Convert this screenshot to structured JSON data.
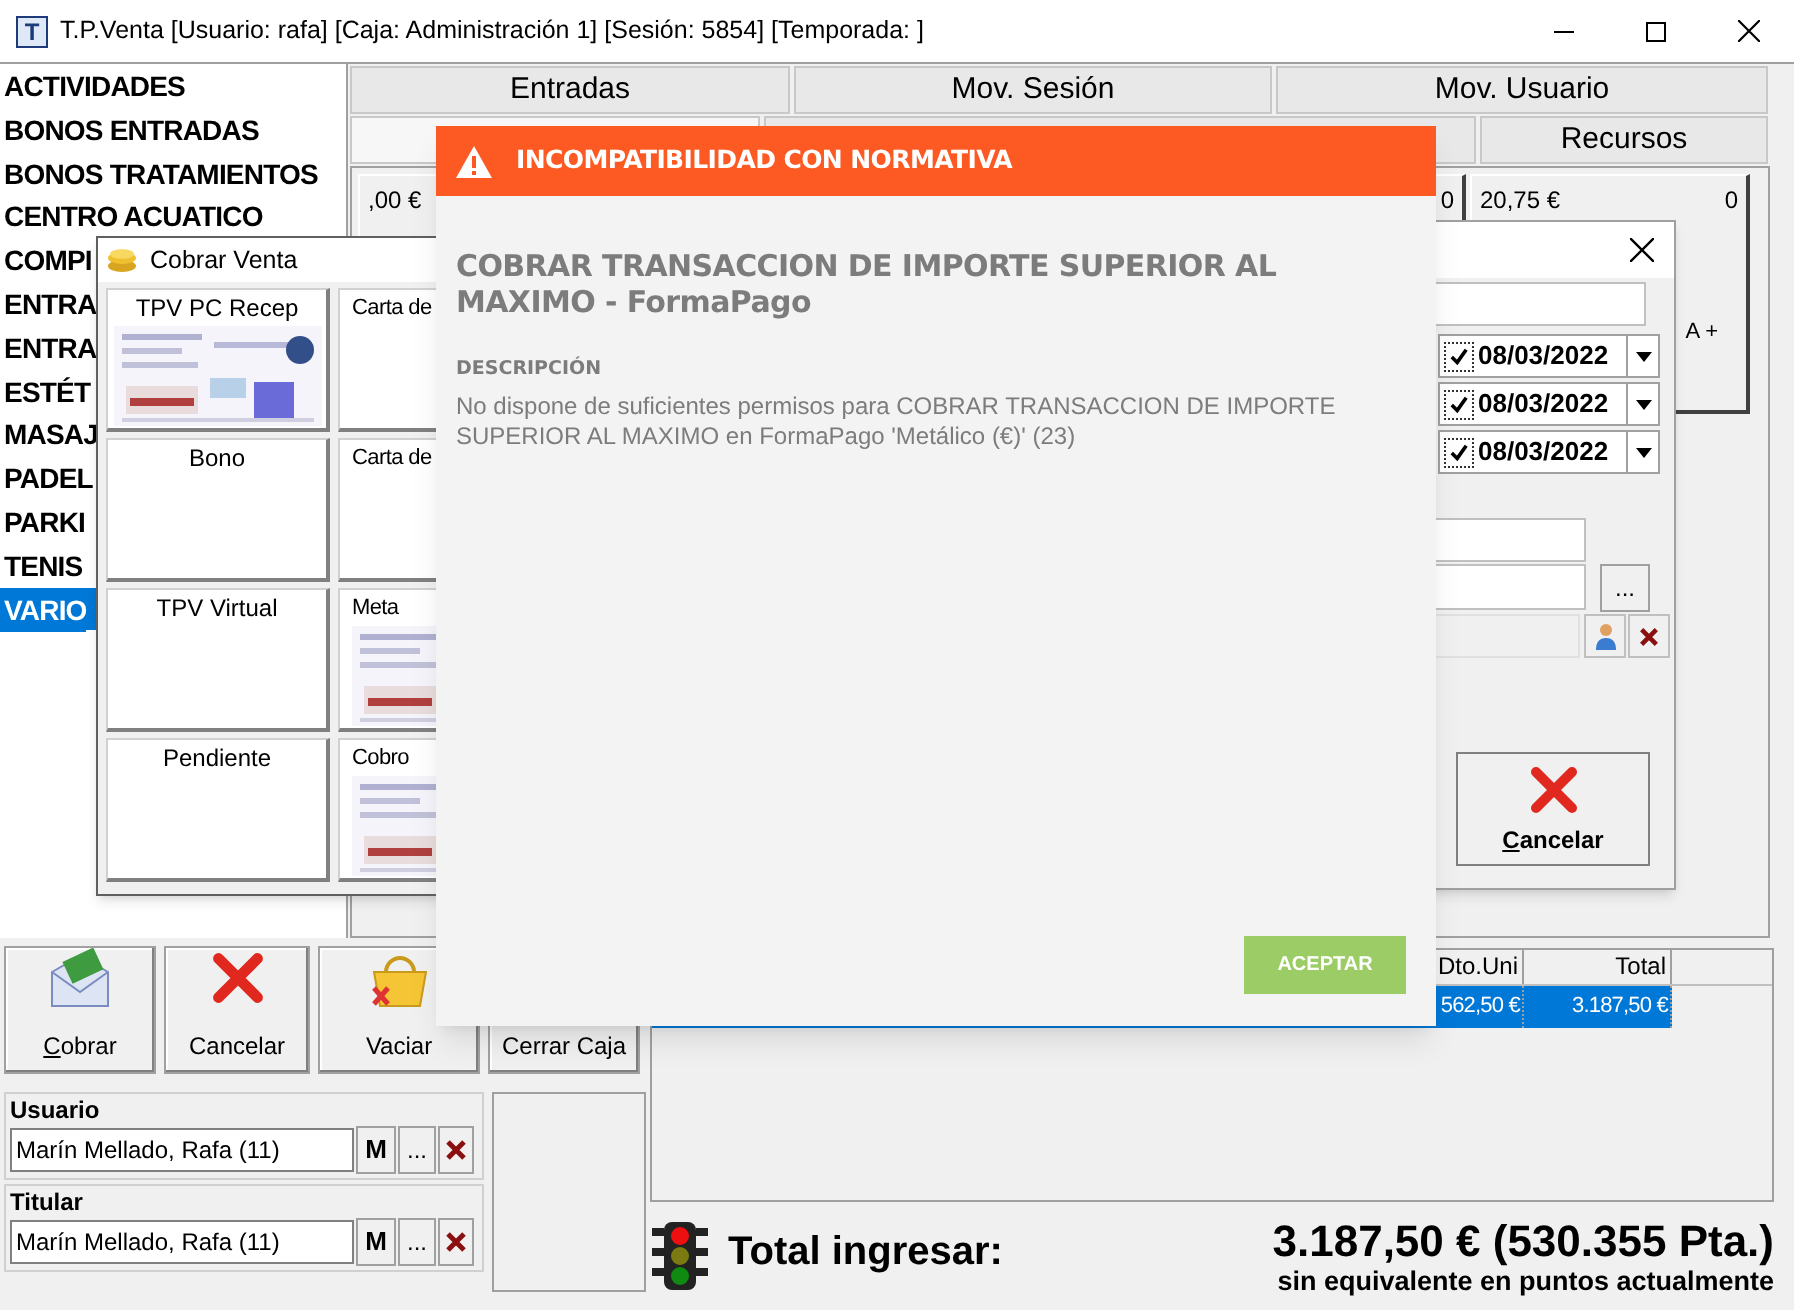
{
  "window": {
    "icon": "T",
    "title": "T.P.Venta [Usuario: rafa] [Caja: Administración 1] [Sesión: 5854] [Temporada: ]"
  },
  "categories": [
    {
      "label": "ACTIVIDADES",
      "selected": false
    },
    {
      "label": "BONOS ENTRADAS",
      "selected": false
    },
    {
      "label": "BONOS TRATAMIENTOS",
      "selected": false
    },
    {
      "label": "CENTRO ACUATICO",
      "selected": false
    },
    {
      "label": "COMPI",
      "selected": false
    },
    {
      "label": "ENTRA",
      "selected": false
    },
    {
      "label": "ENTRA",
      "selected": false
    },
    {
      "label": "ESTÉT",
      "selected": false
    },
    {
      "label": "MASAJ",
      "selected": false
    },
    {
      "label": "PADEL",
      "selected": false
    },
    {
      "label": "PARKI",
      "selected": false
    },
    {
      "label": "TENIS",
      "selected": false
    },
    {
      "label": "VARIO",
      "selected": true
    }
  ],
  "tabs_top": [
    {
      "label": "Entradas",
      "selected": false
    },
    {
      "label": "Mov. Sesión",
      "selected": false
    },
    {
      "label": "Mov. Usuario",
      "selected": false
    }
  ],
  "tabs_bottom": [
    {
      "selected": true
    },
    {
      "label": "Recursos",
      "selected": false
    }
  ],
  "products": [
    {
      "price": ",00 €"
    },
    {
      "count": "0"
    },
    {
      "price": "20,75 €",
      "count": "0",
      "label": "A +"
    }
  ],
  "payment_dialog": {
    "title": "Cobrar Venta",
    "methods": [
      {
        "label": "TPV PC Recep",
        "kind": "picture"
      },
      {
        "label": "Carta de",
        "kind": "plain"
      },
      {
        "label": "Bono",
        "kind": "plain"
      },
      {
        "label": "Carta de",
        "kind": "plain"
      },
      {
        "label": "TPV Virtual",
        "kind": "plain"
      },
      {
        "label": "Meta",
        "kind": "picture"
      },
      {
        "label": "Pendiente",
        "kind": "plain"
      },
      {
        "label": "Cobro",
        "kind": "picture"
      }
    ]
  },
  "side_dialog": {
    "dates": [
      {
        "checked": true,
        "value": "08/03/2022"
      },
      {
        "checked": true,
        "value": "08/03/2022"
      },
      {
        "checked": true,
        "value": "08/03/2022"
      }
    ],
    "browse_button": "...",
    "cancel_button": "Cancelar"
  },
  "alert": {
    "title": "INCOMPATIBILIDAD CON NORMATIVA",
    "heading": "COBRAR TRANSACCION DE IMPORTE SUPERIOR AL MAXIMO - FormaPago",
    "section": "DESCRIPCIÓN",
    "description": "No dispone de suficientes permisos para COBRAR TRANSACCION DE IMPORTE SUPERIOR AL MAXIMO en FormaPago 'Metálico (€)' (23)",
    "button": "ACEPTAR"
  },
  "actions": [
    {
      "label": "Cobrar",
      "kind": "envelope"
    },
    {
      "label": "Cancelar",
      "kind": "cross"
    },
    {
      "label": "Vaciar",
      "kind": "basket"
    },
    {
      "label": "Cerrar Caja",
      "kind": "text"
    }
  ],
  "people": [
    {
      "label": "Usuario",
      "value": "Marín Mellado, Rafa (11)",
      "button": "M",
      "more": "..."
    },
    {
      "label": "Titular",
      "value": "Marín Mellado, Rafa (11)",
      "button": "M",
      "more": "..."
    }
  ],
  "grid": {
    "columns": [
      "Dto.Uni",
      "Total"
    ],
    "rows": [
      {
        "selected": true,
        "cells": [
          "562,50 €",
          "3.187,50 €"
        ]
      }
    ]
  },
  "totals": {
    "label": "Total ingresar:",
    "amount": "3.187,50 € (530.355 Pta.)",
    "note": "sin equivalente en puntos actualmente"
  }
}
